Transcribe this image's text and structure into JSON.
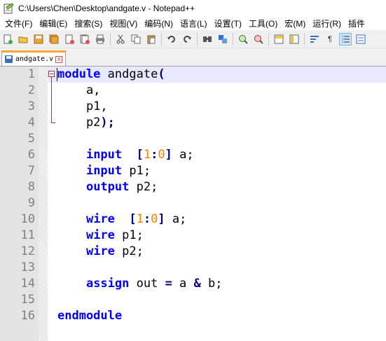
{
  "window": {
    "title": "C:\\Users\\Chen\\Desktop\\andgate.v - Notepad++"
  },
  "menu": [
    "文件(F)",
    "编辑(E)",
    "搜索(S)",
    "视图(V)",
    "编码(N)",
    "语言(L)",
    "设置(T)",
    "工具(O)",
    "宏(M)",
    "运行(R)",
    "插件"
  ],
  "tab": {
    "label": "andgate.v",
    "close": "x"
  },
  "toolbar": {
    "pilcrow": "¶"
  },
  "lines": [
    {
      "n": "1",
      "tokens": [
        {
          "c": "kw",
          "t": "module"
        },
        {
          "c": "",
          "t": " andgate"
        },
        {
          "c": "op",
          "t": "("
        }
      ]
    },
    {
      "n": "2",
      "tokens": [
        {
          "c": "",
          "t": "    a,"
        }
      ]
    },
    {
      "n": "3",
      "tokens": [
        {
          "c": "",
          "t": "    p1,"
        }
      ]
    },
    {
      "n": "4",
      "tokens": [
        {
          "c": "",
          "t": "    p2"
        },
        {
          "c": "op",
          "t": ");"
        }
      ]
    },
    {
      "n": "5",
      "tokens": []
    },
    {
      "n": "6",
      "tokens": [
        {
          "c": "",
          "t": "    "
        },
        {
          "c": "kw",
          "t": "input"
        },
        {
          "c": "",
          "t": "  "
        },
        {
          "c": "op",
          "t": "["
        },
        {
          "c": "num",
          "t": "1"
        },
        {
          "c": "op",
          "t": ":"
        },
        {
          "c": "num",
          "t": "0"
        },
        {
          "c": "op",
          "t": "]"
        },
        {
          "c": "",
          "t": " a;"
        }
      ]
    },
    {
      "n": "7",
      "tokens": [
        {
          "c": "",
          "t": "    "
        },
        {
          "c": "kw",
          "t": "input"
        },
        {
          "c": "",
          "t": " p1;"
        }
      ]
    },
    {
      "n": "8",
      "tokens": [
        {
          "c": "",
          "t": "    "
        },
        {
          "c": "kw",
          "t": "output"
        },
        {
          "c": "",
          "t": " p2;"
        }
      ]
    },
    {
      "n": "9",
      "tokens": []
    },
    {
      "n": "10",
      "tokens": [
        {
          "c": "",
          "t": "    "
        },
        {
          "c": "kw",
          "t": "wire"
        },
        {
          "c": "",
          "t": "  "
        },
        {
          "c": "op",
          "t": "["
        },
        {
          "c": "num",
          "t": "1"
        },
        {
          "c": "op",
          "t": ":"
        },
        {
          "c": "num",
          "t": "0"
        },
        {
          "c": "op",
          "t": "]"
        },
        {
          "c": "",
          "t": " a;"
        }
      ]
    },
    {
      "n": "11",
      "tokens": [
        {
          "c": "",
          "t": "    "
        },
        {
          "c": "kw",
          "t": "wire"
        },
        {
          "c": "",
          "t": " p1;"
        }
      ]
    },
    {
      "n": "12",
      "tokens": [
        {
          "c": "",
          "t": "    "
        },
        {
          "c": "kw",
          "t": "wire"
        },
        {
          "c": "",
          "t": " p2;"
        }
      ]
    },
    {
      "n": "13",
      "tokens": []
    },
    {
      "n": "14",
      "tokens": [
        {
          "c": "",
          "t": "    "
        },
        {
          "c": "kw",
          "t": "assign"
        },
        {
          "c": "",
          "t": " out "
        },
        {
          "c": "op",
          "t": "="
        },
        {
          "c": "",
          "t": " a "
        },
        {
          "c": "op",
          "t": "&"
        },
        {
          "c": "",
          "t": " b;"
        }
      ]
    },
    {
      "n": "15",
      "tokens": []
    },
    {
      "n": "16",
      "tokens": [
        {
          "c": "kw",
          "t": "endmodule"
        }
      ]
    }
  ]
}
